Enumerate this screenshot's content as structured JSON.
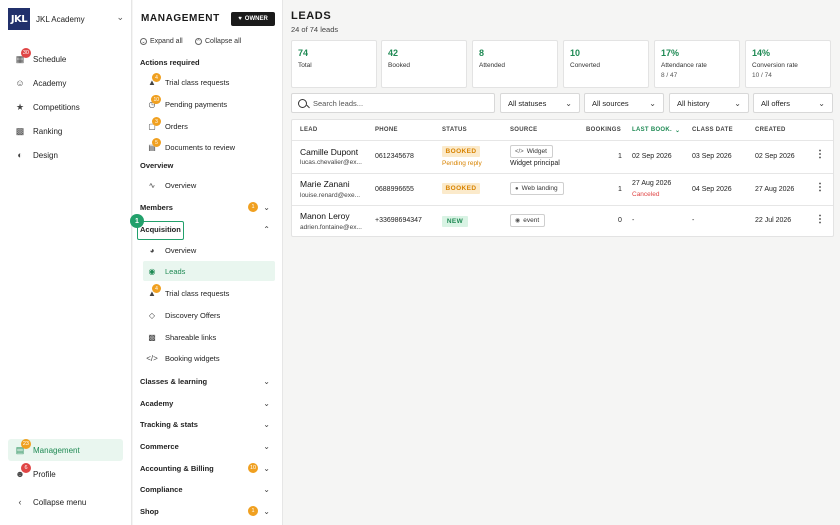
{
  "app": {
    "brand_logo": "JKL",
    "brand_name": "JKL Academy",
    "accent": "#1f8a54"
  },
  "nav": {
    "items": [
      {
        "label": "Schedule",
        "icon": "calendar-icon",
        "badge": "30"
      },
      {
        "label": "Academy",
        "icon": "people-icon",
        "badge": null
      },
      {
        "label": "Competitions",
        "icon": "trophy-icon",
        "badge": null
      },
      {
        "label": "Ranking",
        "icon": "ranking-icon",
        "badge": null
      },
      {
        "label": "Design",
        "icon": "palette-icon",
        "badge": null
      }
    ],
    "management": {
      "label": "Management",
      "badge": "23"
    },
    "profile": {
      "label": "Profile",
      "badge": "6"
    },
    "collapse": "Collapse menu"
  },
  "panel": {
    "title": "MANAGEMENT",
    "owner_badge": "OWNER",
    "expand_all": "Expand all",
    "collapse_all": "Collapse all",
    "actions_required": "Actions required",
    "actions": [
      {
        "label": "Trial class requests",
        "badge": "4"
      },
      {
        "label": "Pending payments",
        "badge": "10"
      },
      {
        "label": "Orders",
        "badge": "3"
      },
      {
        "label": "Documents to review",
        "badge": "5"
      }
    ],
    "overview_section": "Overview",
    "overview_item": "Overview",
    "members": {
      "label": "Members",
      "badge": "1"
    },
    "acquisition": "Acquisition",
    "acq_step": "1",
    "acq_items": [
      {
        "label": "Overview"
      },
      {
        "label": "Leads"
      },
      {
        "label": "Trial class requests",
        "badge": "4"
      },
      {
        "label": "Discovery Offers"
      },
      {
        "label": "Shareable links"
      },
      {
        "label": "Booking widgets"
      }
    ],
    "sections": [
      {
        "label": "Classes & learning",
        "badge": null
      },
      {
        "label": "Academy",
        "badge": null
      },
      {
        "label": "Tracking & stats",
        "badge": null
      },
      {
        "label": "Commerce",
        "badge": null
      },
      {
        "label": "Accounting & Billing",
        "badge": "10"
      },
      {
        "label": "Compliance",
        "badge": null
      },
      {
        "label": "Shop",
        "badge": "1"
      }
    ]
  },
  "main": {
    "title": "LEADS",
    "subtitle": "24 of 74 leads",
    "stats": [
      {
        "value": "74",
        "label": "Total",
        "sub": ""
      },
      {
        "value": "42",
        "label": "Booked",
        "sub": ""
      },
      {
        "value": "8",
        "label": "Attended",
        "sub": ""
      },
      {
        "value": "10",
        "label": "Converted",
        "sub": ""
      },
      {
        "value": "17%",
        "label": "Attendance rate",
        "sub": "8 / 47"
      },
      {
        "value": "14%",
        "label": "Conversion rate",
        "sub": "10 / 74"
      }
    ],
    "search_placeholder": "Search leads...",
    "filters": [
      "All statuses",
      "All sources",
      "All history",
      "All offers"
    ],
    "columns": [
      "LEAD",
      "PHONE",
      "STATUS",
      "SOURCE",
      "BOOKINGS",
      "LAST BOOK.",
      "CLASS DATE",
      "CREATED"
    ],
    "rows": [
      {
        "name": "Camille Dupont",
        "email": "lucas.chevalier@ex...",
        "phone": "0612345678",
        "status": "BOOKED",
        "status_sub": "Pending reply",
        "source": "Widget",
        "source_icon": "code-icon",
        "source_sub": "Widget principal",
        "bookings": "1",
        "last_book": "02 Sep 2026",
        "last_book_sub": "",
        "class_date": "03 Sep 2026",
        "created": "02 Sep 2026"
      },
      {
        "name": "Marie Zanani",
        "email": "louise.renard@exe...",
        "phone": "0688996655",
        "status": "BOOKED",
        "status_sub": "",
        "source": "Web landing",
        "source_icon": "globe-icon",
        "source_sub": "",
        "bookings": "1",
        "last_book": "27 Aug 2026",
        "last_book_sub": "Canceled",
        "class_date": "04 Sep 2026",
        "created": "27 Aug 2026"
      },
      {
        "name": "Manon Leroy",
        "email": "adrien.fontaine@ex...",
        "phone": "+33698694347",
        "status": "NEW",
        "status_sub": "",
        "source": "event",
        "source_icon": "event-icon",
        "source_sub": "",
        "bookings": "0",
        "last_book": "-",
        "last_book_sub": "",
        "class_date": "-",
        "created": "22 Jul 2026"
      }
    ]
  }
}
